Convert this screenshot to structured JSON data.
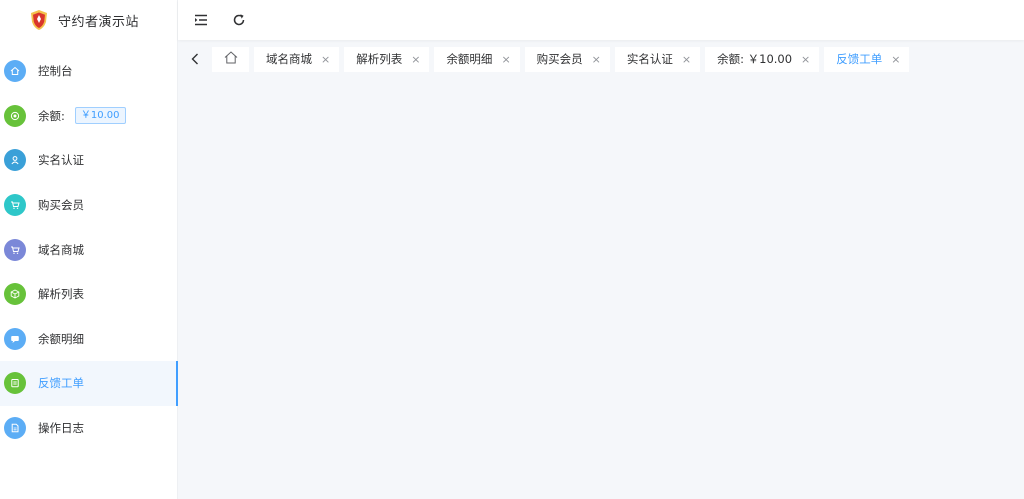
{
  "app": {
    "title": "守约者演示站"
  },
  "sidebar": {
    "items": [
      {
        "label": "控制台",
        "color": "#5cadf5",
        "icon": "home-icon",
        "active": false
      },
      {
        "label": "余额:",
        "color": "#67c23a",
        "icon": "target-icon",
        "active": false,
        "tag": "￥10.00"
      },
      {
        "label": "实名认证",
        "color": "#3aa0d8",
        "icon": "user-icon",
        "active": false
      },
      {
        "label": "购买会员",
        "color": "#2ec7c9",
        "icon": "cart-icon",
        "active": false
      },
      {
        "label": "域名商城",
        "color": "#7b88d8",
        "icon": "cart-icon",
        "active": false
      },
      {
        "label": "解析列表",
        "color": "#67c23a",
        "icon": "cube-icon",
        "active": false
      },
      {
        "label": "余额明细",
        "color": "#5cadf5",
        "icon": "chat-icon",
        "active": false
      },
      {
        "label": "反馈工单",
        "color": "#67c23a",
        "icon": "ticket-icon",
        "active": true
      },
      {
        "label": "操作日志",
        "color": "#5cadf5",
        "icon": "document-icon",
        "active": false
      }
    ]
  },
  "tabs": [
    {
      "label": "域名商城",
      "active": false
    },
    {
      "label": "解析列表",
      "active": false
    },
    {
      "label": "余额明细",
      "active": false
    },
    {
      "label": "购买会员",
      "active": false
    },
    {
      "label": "实名认证",
      "active": false
    },
    {
      "label": "余额: ￥10.00",
      "active": false
    },
    {
      "label": "反馈工单",
      "active": true
    }
  ],
  "tab_close_glyph": "×",
  "colors": {
    "accent": "#409eff",
    "background": "#f5f7fa"
  }
}
